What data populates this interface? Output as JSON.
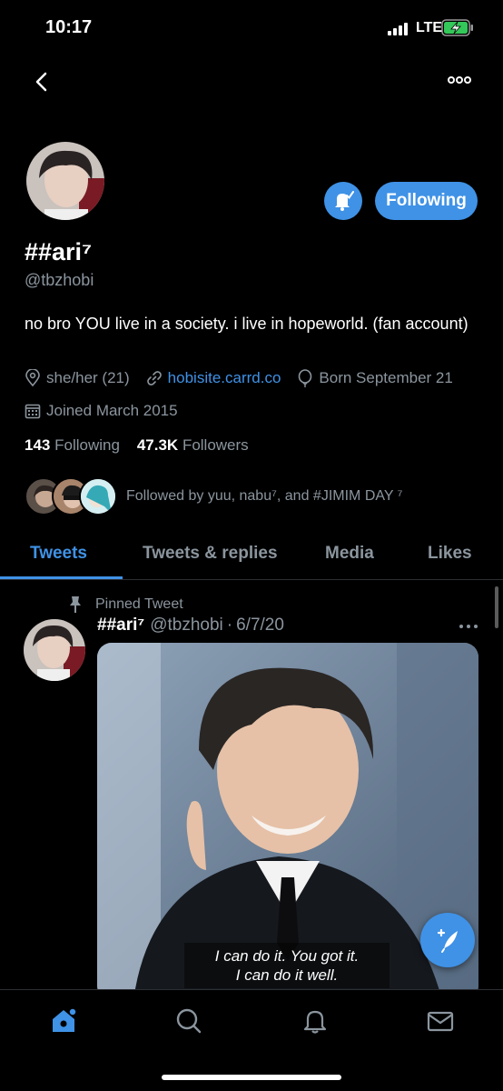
{
  "status_bar": {
    "time": "10:17",
    "network": "LTE",
    "icons": [
      "signal-icon",
      "battery-charging-icon"
    ]
  },
  "nav": {
    "icons": [
      "back-chevron-icon",
      "more-dots-icon"
    ]
  },
  "profile": {
    "display_name": "##ari⁷",
    "handle": "@tbzhobi",
    "bio": "no bro YOU live in a society. i live in hopeworld. (fan account)",
    "pronouns": "she/her (21)",
    "website": "hobisite.carrd.co",
    "birthday": "Born September 21",
    "joined": "Joined March 2015",
    "following_count": "143",
    "following_label": "Following",
    "followers_count": "47.3K",
    "followers_label": "Followers",
    "followed_by": "Followed by yuu, nabu⁷, and #JIMIM DAY ⁷",
    "follow_button_label": "Following"
  },
  "tabs": [
    {
      "label": "Tweets",
      "active": true
    },
    {
      "label": "Tweets & replies",
      "active": false
    },
    {
      "label": "Media",
      "active": false
    },
    {
      "label": "Likes",
      "active": false
    }
  ],
  "pinned_tweet": {
    "pin_label": "Pinned Tweet",
    "author_name": "##ari⁷",
    "author_handle": "@tbzhobi",
    "separator": "·",
    "date": "6/7/20",
    "caption_line1": "I can do it. You got it.",
    "caption_line2": "I can do it well."
  },
  "bottom_nav": {
    "icons": [
      "home-icon",
      "search-icon",
      "notifications-bell-icon",
      "messages-mail-icon"
    ]
  },
  "colors": {
    "accent": "#3f92e6",
    "background": "#000000",
    "secondary_text": "#8b959e",
    "divider": "#2c2f33"
  }
}
